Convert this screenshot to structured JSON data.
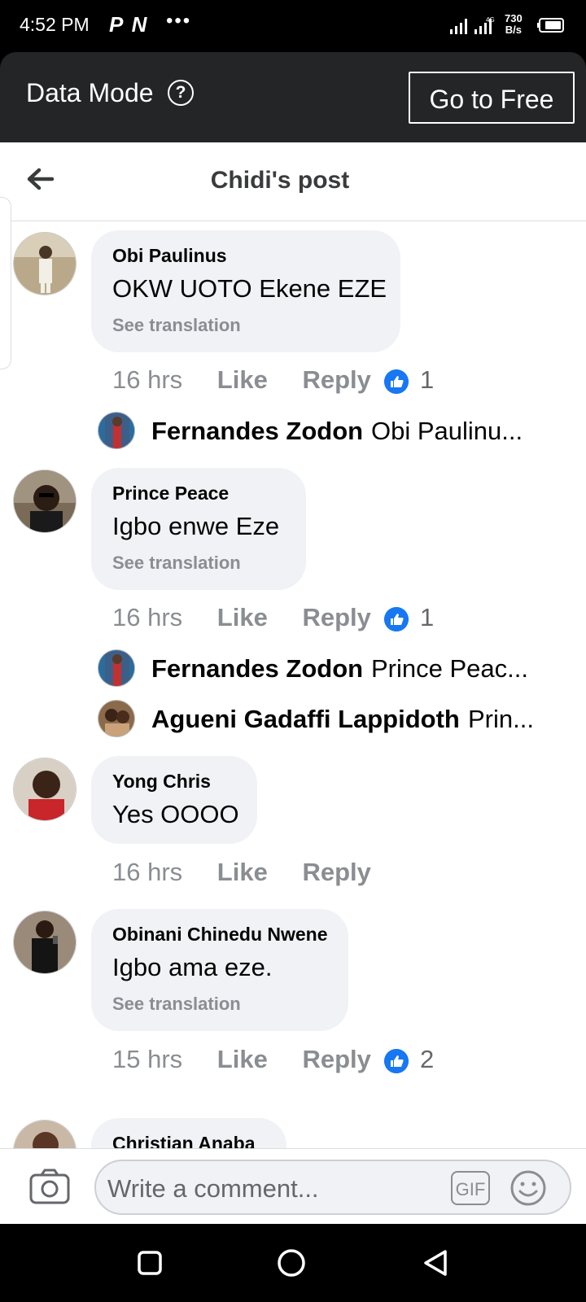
{
  "status_bar": {
    "time": "4:52 PM",
    "app_icons": "P N",
    "dots": "•••",
    "network": "4G",
    "speed_value": "730",
    "speed_unit": "B/s"
  },
  "data_mode": {
    "label": "Data Mode",
    "help_symbol": "?",
    "button_label": "Go to Free"
  },
  "header": {
    "title": "Chidi's post"
  },
  "comments": [
    {
      "author": "Obi Paulinus",
      "text": "OKW UOTO Ekene EZE",
      "translation": "See translation",
      "time": "16 hrs",
      "like_label": "Like",
      "reply_label": "Reply",
      "reactions": "1",
      "replies": [
        {
          "author": "Fernandes Zodon",
          "preview": "Obi Paulinu..."
        }
      ]
    },
    {
      "author": "Prince Peace",
      "text": "Igbo enwe Eze",
      "translation": "See translation",
      "time": "16 hrs",
      "like_label": "Like",
      "reply_label": "Reply",
      "reactions": "1",
      "replies": [
        {
          "author": "Fernandes Zodon",
          "preview": "Prince Peac..."
        },
        {
          "author": "Agueni Gadaffi Lappidoth",
          "preview": "Prin..."
        }
      ]
    },
    {
      "author": "Yong Chris",
      "text": "Yes OOOO",
      "time": "16 hrs",
      "like_label": "Like",
      "reply_label": "Reply"
    },
    {
      "author": "Obinani Chinedu Nwene",
      "text": "Igbo ama eze.",
      "translation": "See translation",
      "time": "15 hrs",
      "like_label": "Like",
      "reply_label": "Reply",
      "reactions": "2"
    },
    {
      "author": "Christian Anaba"
    }
  ],
  "composer": {
    "placeholder": "Write a comment...",
    "gif_label": "GIF"
  },
  "colors": {
    "like_blue": "#1877f2",
    "bubble_bg": "#f0f2f5",
    "secondary_text": "#8a8d91",
    "data_bar_bg": "#242526"
  }
}
